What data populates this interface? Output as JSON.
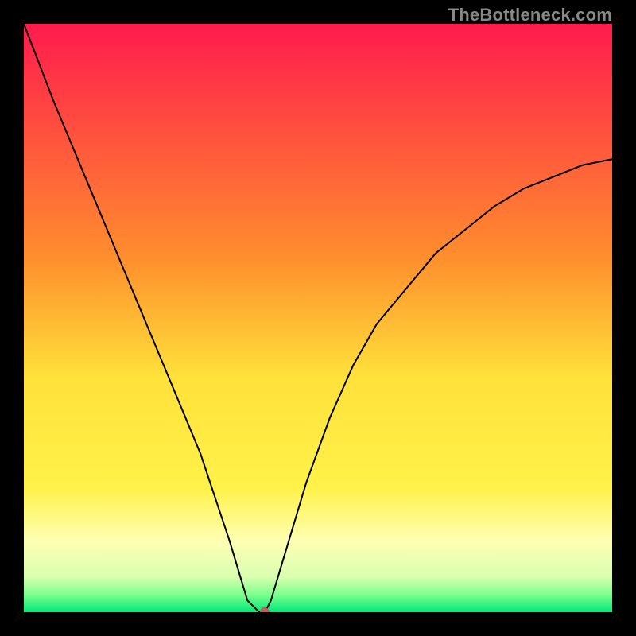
{
  "attribution": {
    "text": "TheBottleneck.com",
    "color": "#888888"
  },
  "chart_data": {
    "type": "line",
    "title": "",
    "xlabel": "",
    "ylabel": "",
    "xlim": [
      0,
      100
    ],
    "ylim": [
      0,
      100
    ],
    "grid": false,
    "legend": false,
    "background_gradient_stops": [
      {
        "pos": 0,
        "color": "#ff1b4d"
      },
      {
        "pos": 40,
        "color": "#ff8f2d"
      },
      {
        "pos": 60,
        "color": "#ffe13a"
      },
      {
        "pos": 79,
        "color": "#fff24a"
      },
      {
        "pos": 88,
        "color": "#feffb3"
      },
      {
        "pos": 94,
        "color": "#d9ffb0"
      },
      {
        "pos": 97,
        "color": "#7dff8c"
      },
      {
        "pos": 100,
        "color": "#00e87a"
      }
    ],
    "series": [
      {
        "name": "bottleneck-curve",
        "color": "#000000",
        "x": [
          0,
          5,
          10,
          15,
          20,
          25,
          30,
          35,
          38,
          40,
          41,
          42,
          45,
          48,
          52,
          56,
          60,
          65,
          70,
          75,
          80,
          85,
          90,
          95,
          100
        ],
        "y": [
          100,
          87,
          75,
          63,
          51,
          39,
          27,
          12,
          2,
          0,
          0,
          2,
          12,
          22,
          33,
          42,
          49,
          55,
          61,
          65,
          69,
          72,
          74,
          76,
          77
        ]
      }
    ],
    "marker": {
      "name": "optimum-point",
      "x": 41,
      "y": 0,
      "color": "#c85a5a"
    }
  }
}
